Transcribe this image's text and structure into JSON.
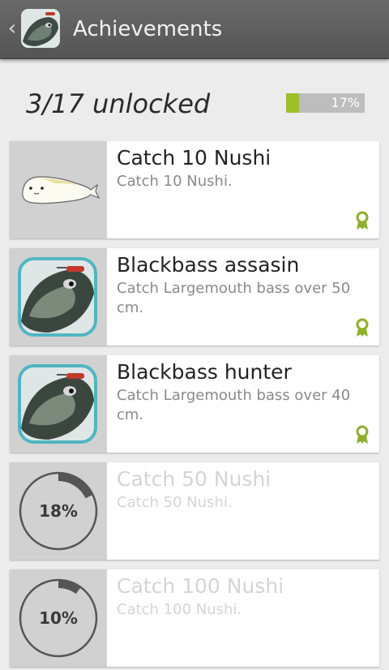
{
  "actionbar": {
    "title": "Achievements",
    "up_icon": "chevron-left-icon",
    "app_icon": "bass-fish-app-icon"
  },
  "summary": {
    "text": "3/17 unlocked",
    "progress_label": "17%",
    "progress_fraction": 0.17,
    "accent_color": "#9cbf2a"
  },
  "achievements": [
    {
      "title": "Catch 10 Nushi",
      "description": "Catch 10 Nushi.",
      "icon": "white-catfish-icon",
      "unlocked": true,
      "award_icon": "ribbon-award-icon"
    },
    {
      "title": "Blackbass assasin",
      "description": "Catch  Largemouth bass over 50 cm.",
      "icon": "largemouth-bass-icon",
      "unlocked": true,
      "award_icon": "ribbon-award-icon"
    },
    {
      "title": "Blackbass hunter",
      "description": "Catch  Largemouth bass over 40 cm.",
      "icon": "largemouth-bass-icon",
      "unlocked": true,
      "award_icon": "ribbon-award-icon"
    },
    {
      "title": "Catch 50 Nushi",
      "description": "Catch 50 Nushi.",
      "unlocked": false,
      "progress_label": "18%",
      "progress_fraction": 0.18
    },
    {
      "title": "Catch 100 Nushi",
      "description": "Catch 100 Nushi.",
      "unlocked": false,
      "progress_label": "10%",
      "progress_fraction": 0.1
    }
  ]
}
